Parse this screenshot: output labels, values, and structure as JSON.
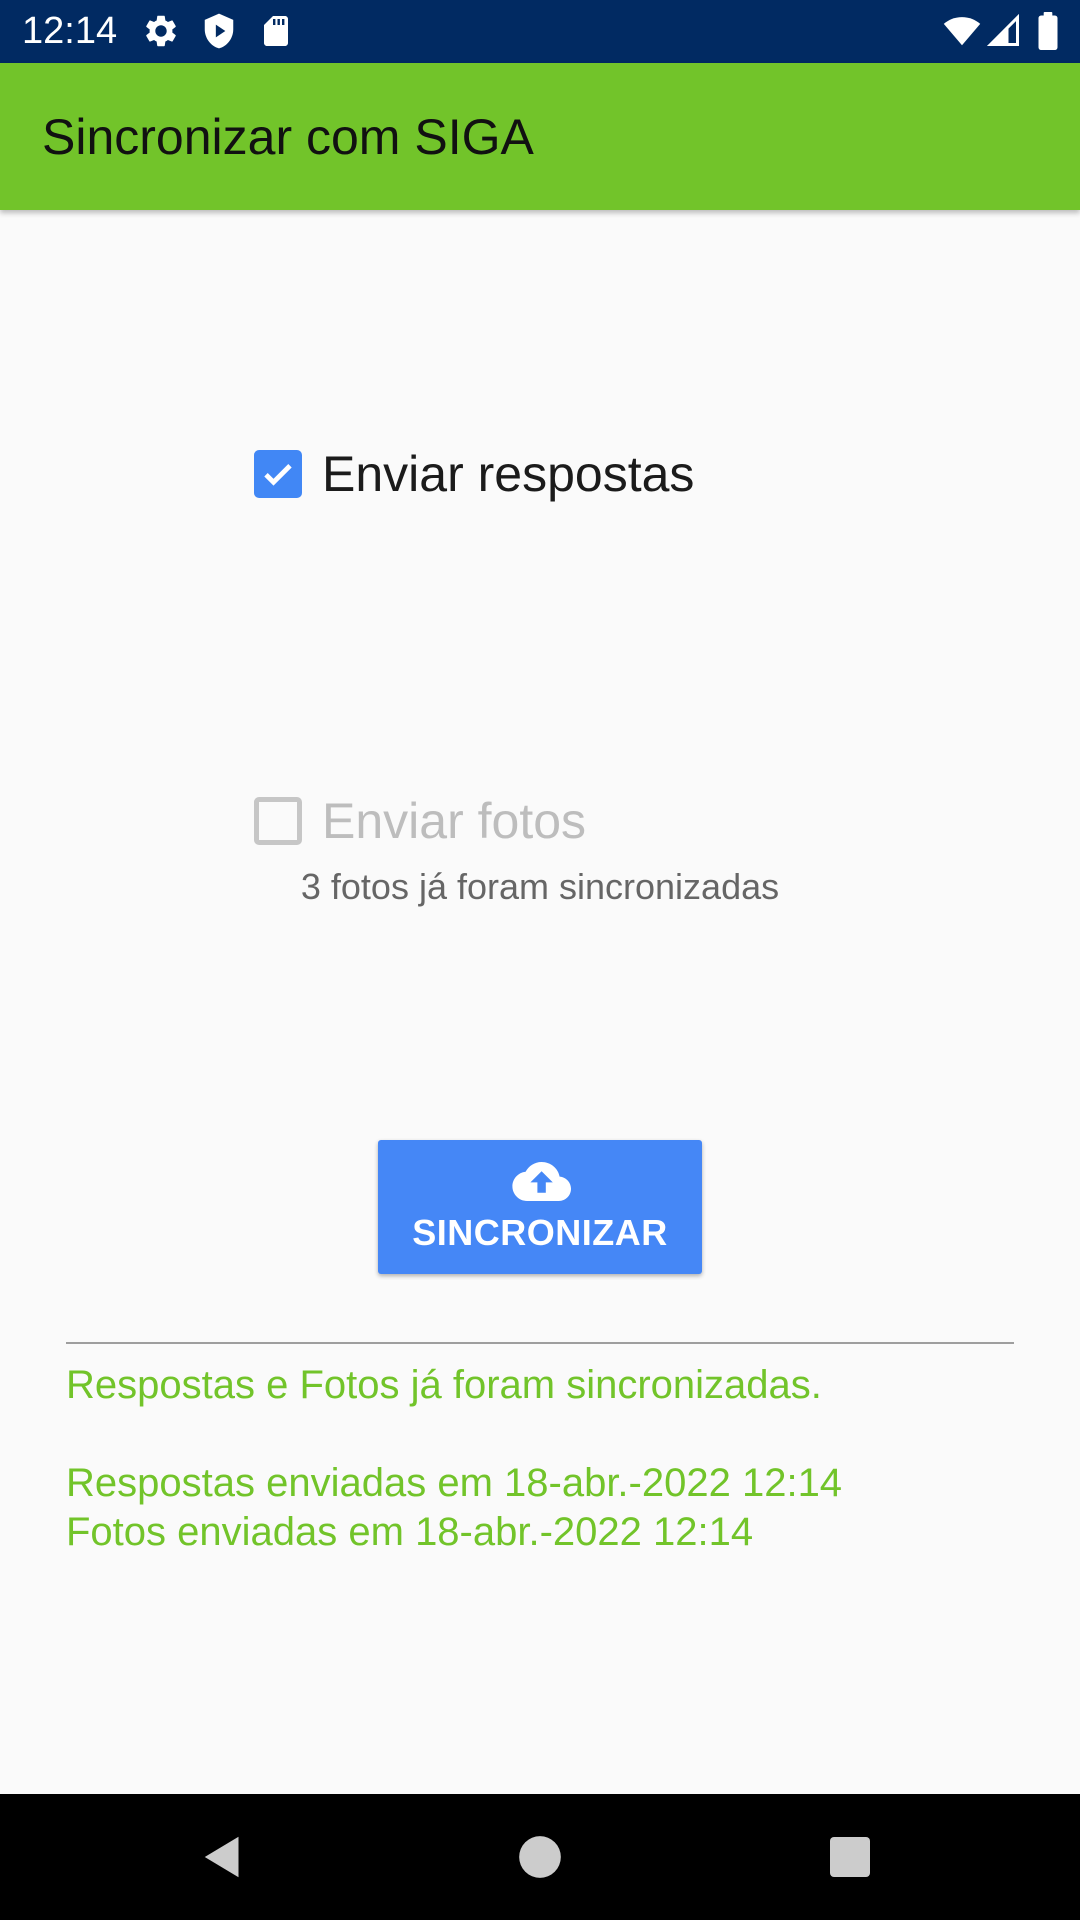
{
  "status_bar": {
    "time": "12:14",
    "icons": [
      "gear-icon",
      "shield-icon",
      "sd-card-icon",
      "wifi-icon",
      "signal-icon",
      "battery-icon"
    ]
  },
  "app_bar": {
    "title": "Sincronizar com SIGA",
    "color": "#72c42a"
  },
  "options": {
    "send_answers": {
      "label": "Enviar respostas",
      "checked": true
    },
    "send_photos": {
      "label": "Enviar fotos",
      "checked": false,
      "note": "3 fotos já foram sincronizadas"
    }
  },
  "sync_button": {
    "label": "SINCRONIZAR",
    "icon": "cloud-upload-icon",
    "color": "#4587f6"
  },
  "status": {
    "summary": "Respostas e Fotos já foram sincronizadas.",
    "answers_sent": "Respostas enviadas em 18-abr.-2022 12:14",
    "photos_sent": "Fotos enviadas em 18-abr.-2022 12:14"
  },
  "nav_bar": {
    "buttons": [
      "back-icon",
      "home-icon",
      "recents-icon"
    ]
  }
}
